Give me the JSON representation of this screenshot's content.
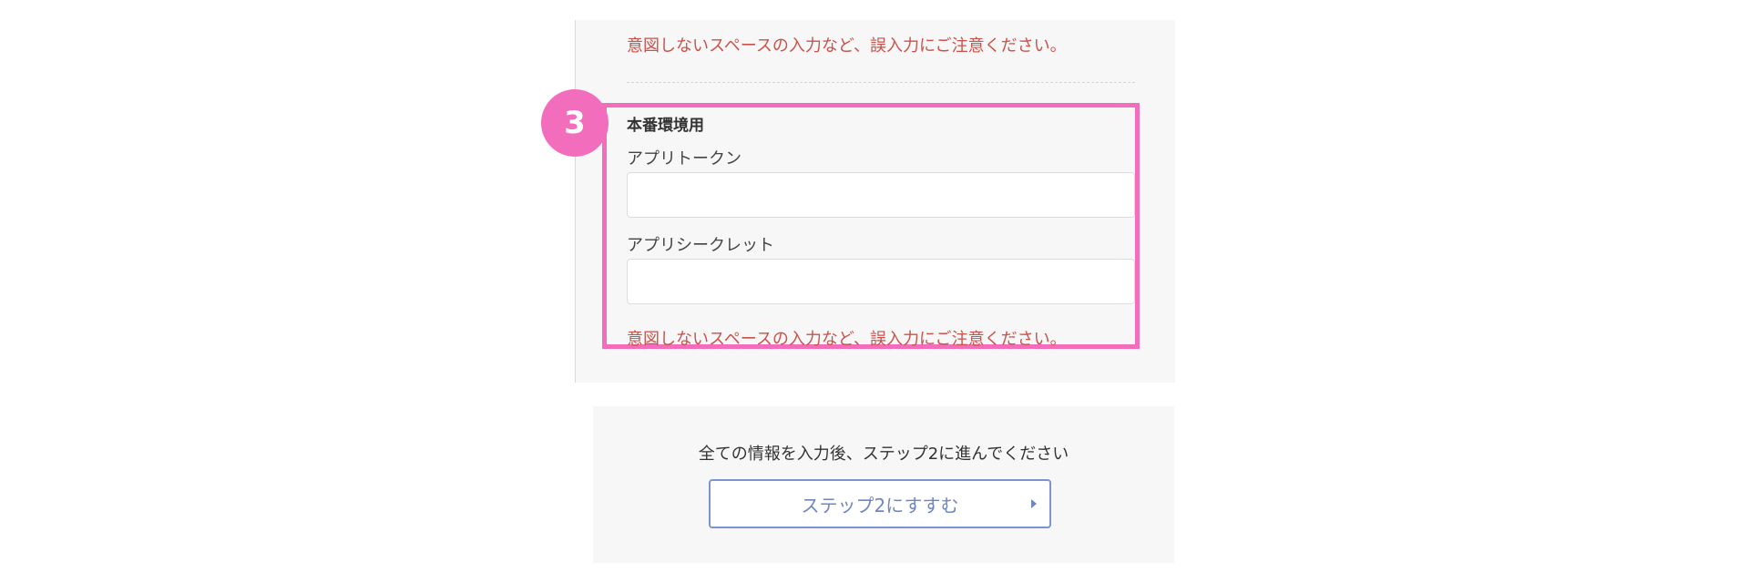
{
  "development_notice": "意図しないスペースの入力など、誤入力にご注意ください。",
  "production": {
    "step_number": "3",
    "section_title": "本番環境用",
    "app_token_label": "アプリトークン",
    "app_token_value": "",
    "app_secret_label": "アプリシークレット",
    "app_secret_value": "",
    "notice": "意図しないスペースの入力など、誤入力にご注意ください。"
  },
  "footer": {
    "instruction": "全ての情報を入力後、ステップ2に進んでください",
    "next_button_label": "ステップ2にすすむ",
    "next_button_icon": "triangle-right-icon"
  },
  "colors": {
    "highlight": "#f26ebc",
    "warning_text": "#c9524a",
    "button_accent": "#6f86c3",
    "panel_background": "#f7f7f8"
  }
}
